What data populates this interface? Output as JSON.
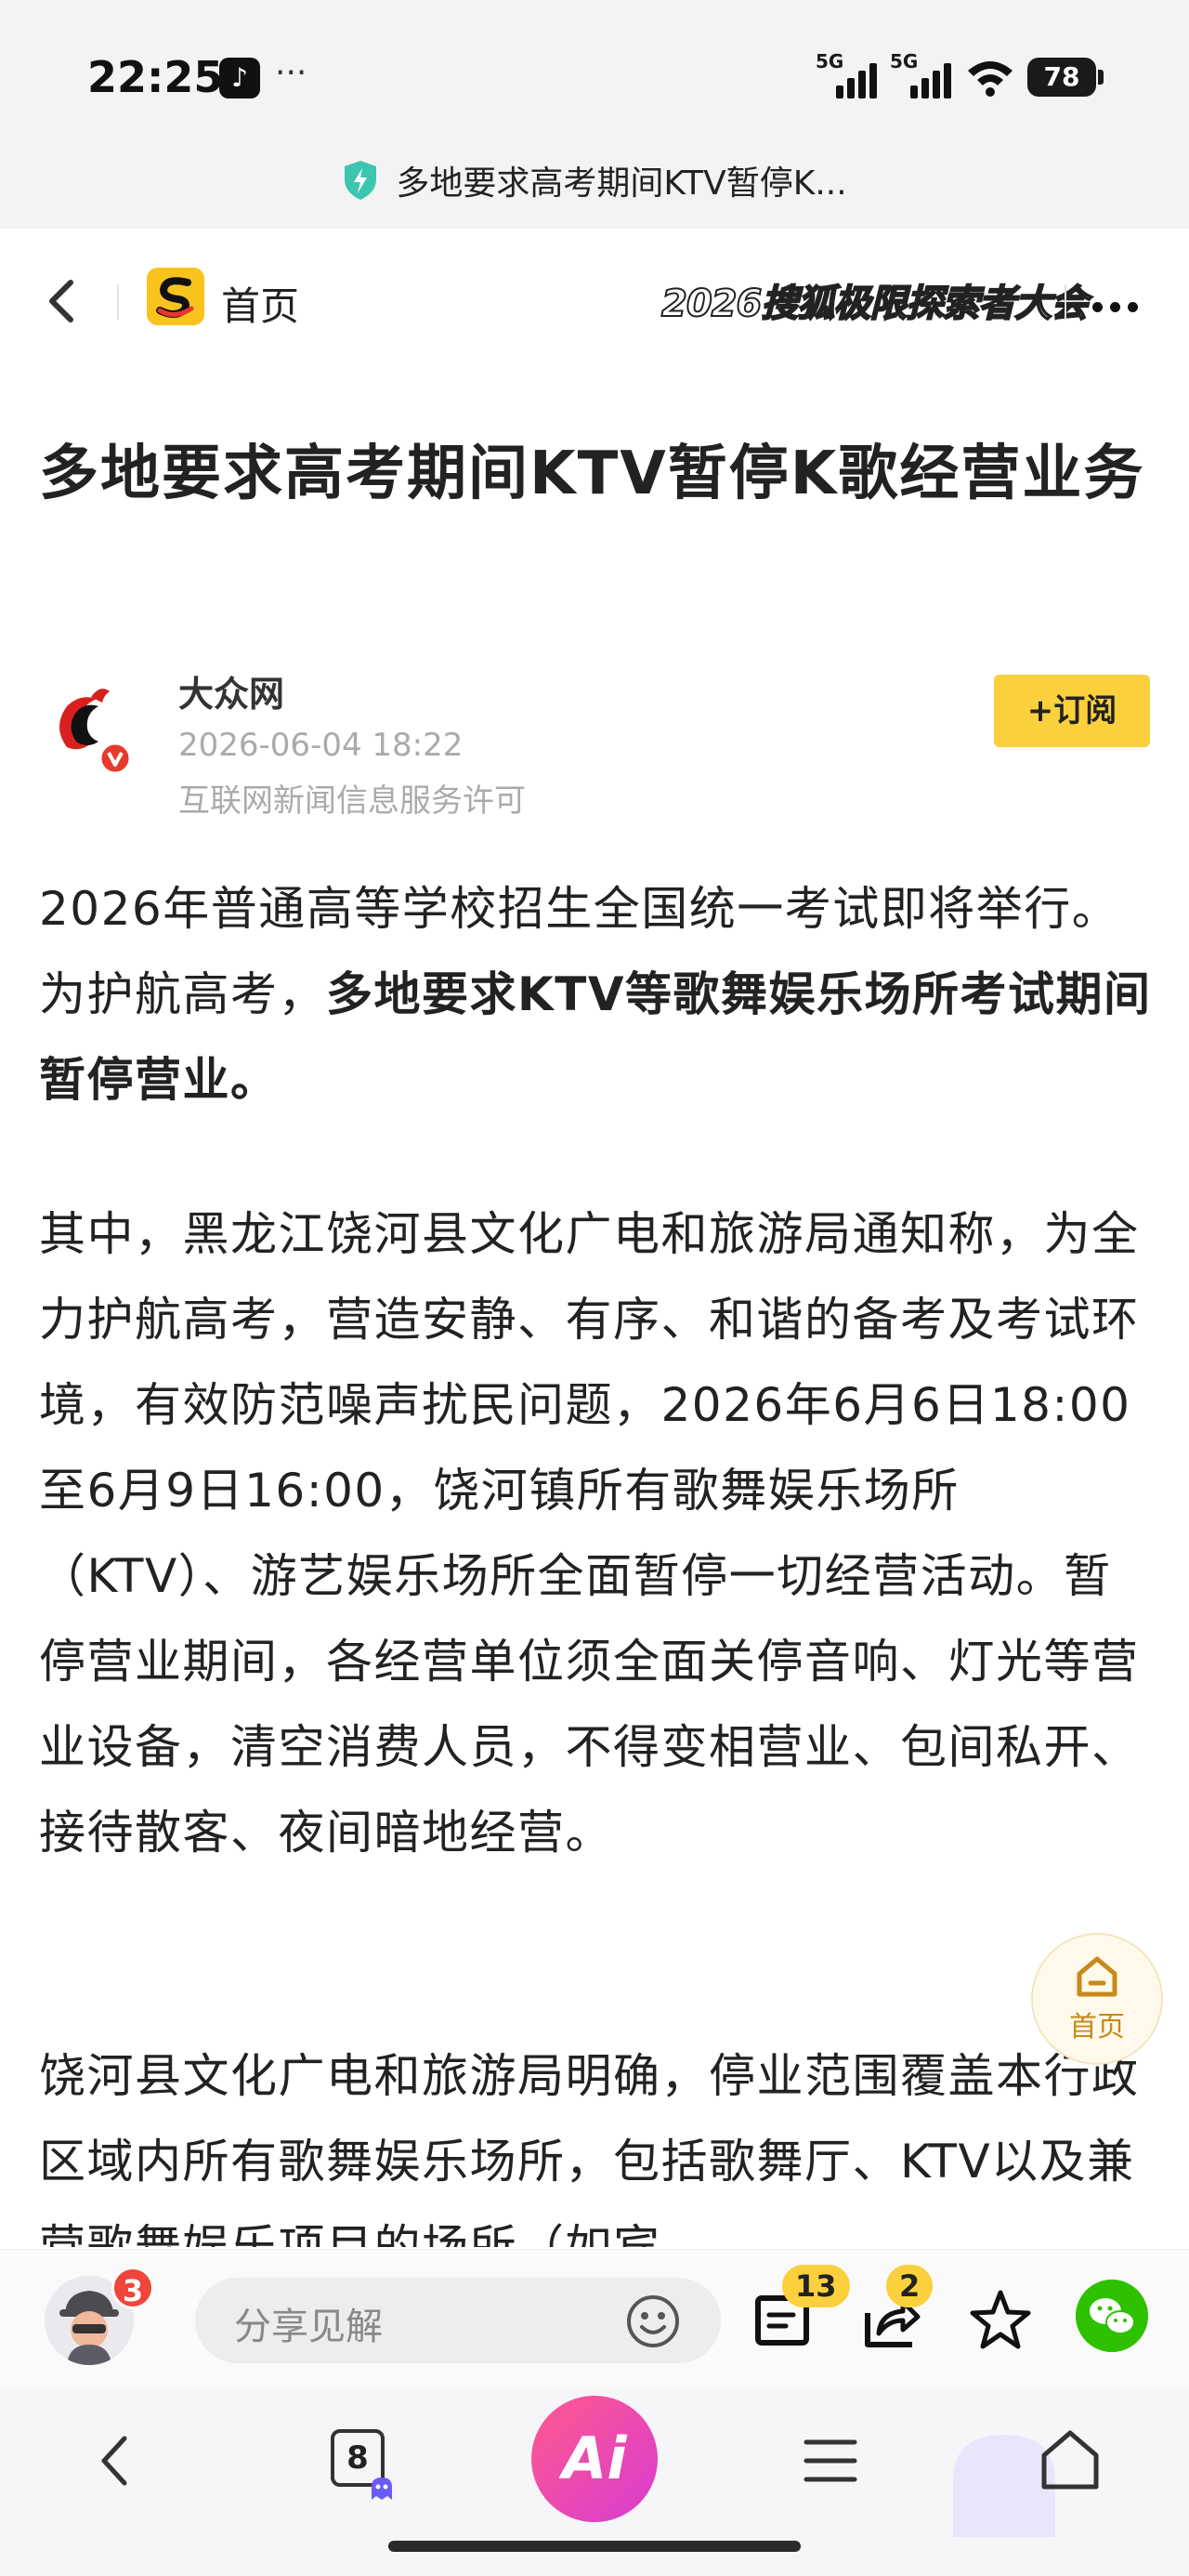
{
  "status_bar": {
    "time": "22:25",
    "tiktok_icon": "tiktok-icon",
    "more": "···",
    "signal1_label": "5G",
    "signal2_label": "5G",
    "battery": "78"
  },
  "url_bar": {
    "title": "多地要求高考期间KTV暂停K..."
  },
  "nav": {
    "home_label": "首页",
    "banner": "2026搜狐极限探索者大会"
  },
  "article": {
    "title": "多地要求高考期间KTV暂停K歌经营业务",
    "author": {
      "name": "大众网",
      "date": "2026-06-04 18:22",
      "license": "互联网新闻信息服务许可",
      "subscribe_label": "+订阅"
    },
    "para1_a": "2026年普通高等学校招生全国统一考试即将举行。为护航高考，",
    "para1_b": "多地要求KTV等歌舞娱乐场所考试期间暂停营业。",
    "para2": "其中，黑龙江饶河县文化广电和旅游局通知称，为全力护航高考，营造安静、有序、和谐的备考及考试环境，有效防范噪声扰民问题，2026年6月6日18:00至6月9日16:00，饶河镇所有歌舞娱乐场所（KTV）、游艺娱乐场所全面暂停一切经营活动。暂停营业期间，各经营单位须全面关停音响、灯光等营业设备，清空消费人员，不得变相营业、包间私开、接待散客、夜间暗地经营。",
    "para3": "饶河县文化广电和旅游局明确，停业范围覆盖本行政区域内所有歌舞娱乐场所，包括歌舞厅、KTV以及兼营歌舞娱乐项目的场所（如宾"
  },
  "float_home": {
    "label": "首页"
  },
  "comment_bar": {
    "avatar_badge": "3",
    "placeholder": "分享见解",
    "comment_count": "13",
    "share_count": "2"
  },
  "browser_nav": {
    "tab_count": "8",
    "ai_label": "Ai"
  },
  "colors": {
    "accent_yellow": "#fbd03d",
    "badge_red": "#f0453a",
    "wechat_green": "#2dc100",
    "float_home_text": "#c78a1b"
  }
}
